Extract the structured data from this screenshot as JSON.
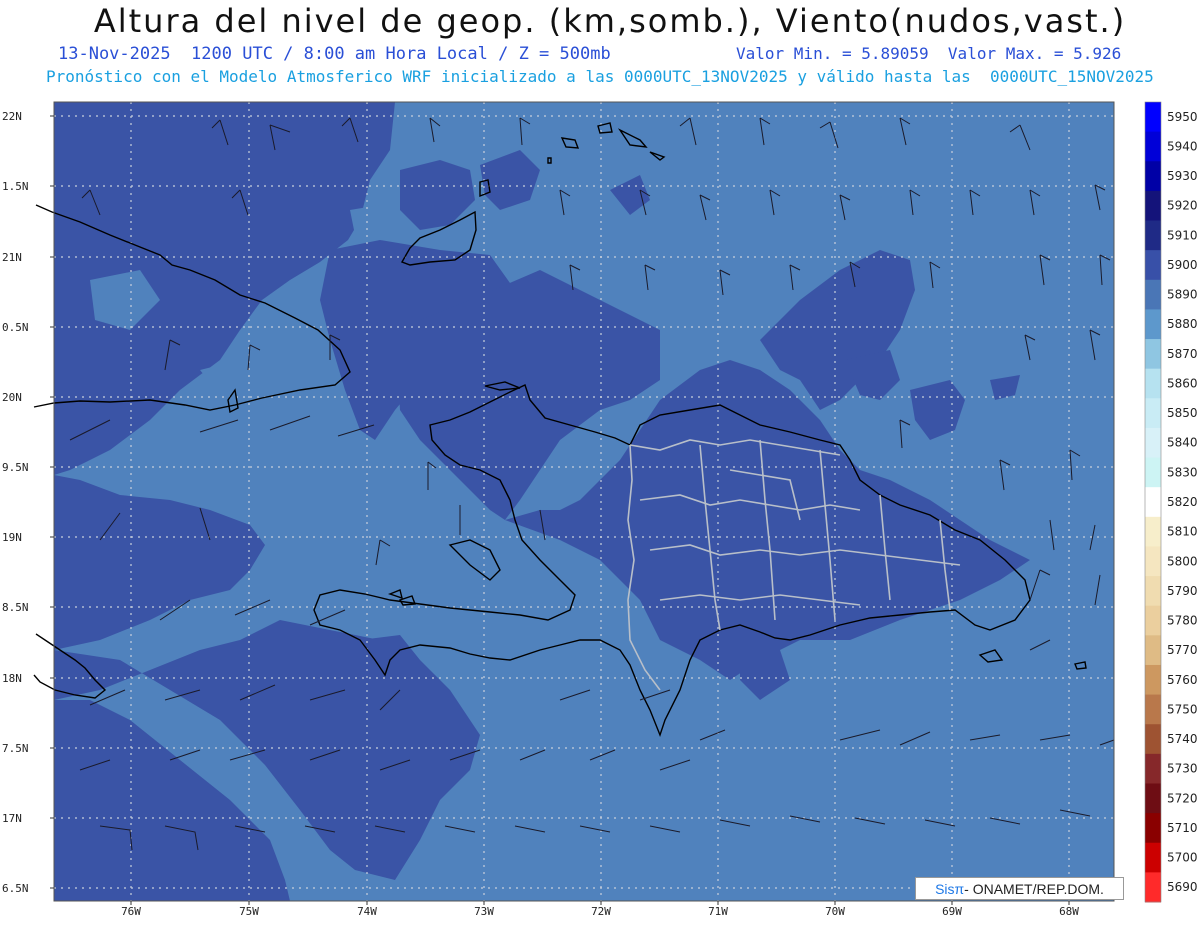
{
  "header": {
    "title": "Altura del nivel de geop. (km,somb.), Viento(nudos,vast.)",
    "date_line": "13-Nov-2025  1200 UTC / 8:00 am Hora Local / Z = 500mb",
    "minmax_line": "Valor Min. = 5.89059  Valor Max. = 5.926",
    "model_line": "Pronóstico con el Modelo Atmosferico WRF inicializado a las 0000UTC_13NOV2025 y válido hasta las  0000UTC_15NOV2025"
  },
  "axes": {
    "lat_labels": [
      "22N",
      "1.5N",
      "21N",
      "0.5N",
      "20N",
      "9.5N",
      "19N",
      "8.5N",
      "18N",
      "7.5N",
      "17N",
      "6.5N"
    ],
    "lon_labels": [
      "76W",
      "75W",
      "74W",
      "73W",
      "72W",
      "71W",
      "70W",
      "69W",
      "68W"
    ]
  },
  "colorbar": {
    "levels": [
      "5950",
      "5940",
      "5930",
      "5920",
      "5910",
      "5900",
      "5890",
      "5880",
      "5870",
      "5860",
      "5850",
      "5840",
      "5830",
      "5820",
      "5810",
      "5800",
      "5790",
      "5780",
      "5770",
      "5760",
      "5750",
      "5740",
      "5730",
      "5720",
      "5710",
      "5700",
      "5690"
    ],
    "colors": [
      "#0000ff",
      "#0000d8",
      "#0000a6",
      "#14137a",
      "#1f2a86",
      "#3850a8",
      "#4a76b6",
      "#5d98cc",
      "#8fc6e2",
      "#b6e2f0",
      "#c9ecf5",
      "#d8f1f8",
      "#cdf4f4",
      "#ffffff",
      "#f7eecb",
      "#f5e6c0",
      "#f0dcb0",
      "#ebcf9e",
      "#dfbb85",
      "#cd9860",
      "#b9784b",
      "#9e5332",
      "#86282a",
      "#6e0d14",
      "#8a0000",
      "#cc0000",
      "#ff2a2a"
    ]
  },
  "credit": {
    "sis": "Sisπ",
    "rest": "- ONAMET/REP.DOM."
  }
}
